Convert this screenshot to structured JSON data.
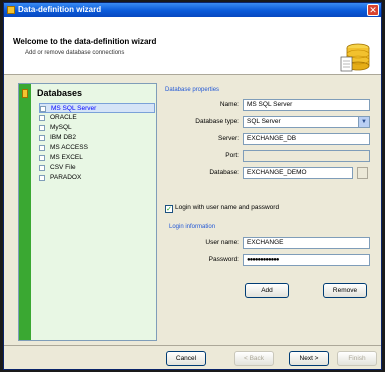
{
  "window": {
    "title": "Data-definition wizard",
    "close_glyph": "✕"
  },
  "header": {
    "title": "Welcome to the data-definition wizard",
    "subtitle": "Add or remove database connections"
  },
  "sidebar": {
    "heading": "Databases",
    "items": [
      {
        "label": "MS SQL Server",
        "selected": true
      },
      {
        "label": "ORACLE"
      },
      {
        "label": "MySQL"
      },
      {
        "label": "IBM DB2"
      },
      {
        "label": "MS ACCESS"
      },
      {
        "label": "MS EXCEL"
      },
      {
        "label": "CSV File"
      },
      {
        "label": "PARADOX"
      }
    ]
  },
  "db_properties": {
    "group_label": "Database properties",
    "name_label": "Name:",
    "name_value": "MS SQL Server",
    "type_label": "Database type:",
    "type_value": "SQL Server",
    "server_label": "Server:",
    "server_value": "EXCHANGE_DB",
    "port_label": "Port:",
    "port_value": "",
    "database_label": "Database:",
    "database_value": "EXCHANGE_DEMO"
  },
  "login": {
    "checkbox_label": "Login with user name and password",
    "checked": true,
    "group_label": "Login information",
    "user_label": "User name:",
    "user_value": "EXCHANGE",
    "password_label": "Password:",
    "password_value": "●●●●●●●●●●●●"
  },
  "actions": {
    "add": "Add",
    "remove": "Remove"
  },
  "footer": {
    "cancel": "Cancel",
    "back": "< Back",
    "next": "Next >",
    "finish": "Finish"
  },
  "colors": {
    "titlebar": "#0a5ad9",
    "sidebar_stripe": "#3aa832",
    "sidebar_bg": "#e8f7e4",
    "group_label": "#2258d6"
  }
}
